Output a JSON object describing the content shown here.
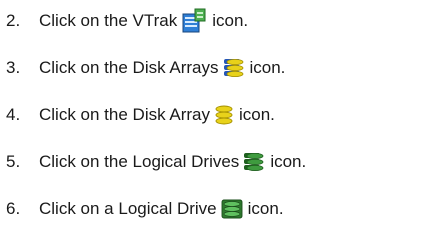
{
  "steps": [
    {
      "number": "2.",
      "text_before": "Click on the VTrak",
      "icon": "vtrak-icon",
      "text_after": "icon."
    },
    {
      "number": "3.",
      "text_before": "Click on the Disk Arrays",
      "icon": "disk-arrays-icon",
      "text_after": "icon."
    },
    {
      "number": "4.",
      "text_before": "Click on the Disk Array",
      "icon": "disk-array-icon",
      "text_after": "icon."
    },
    {
      "number": "5.",
      "text_before": "Click on the Logical Drives",
      "icon": "logical-drives-icon",
      "text_after": "icon."
    },
    {
      "number": "6.",
      "text_before": "Click on a Logical Drive",
      "icon": "logical-drive-icon",
      "text_after": "icon."
    }
  ],
  "colors": {
    "text": "#1a1a1a",
    "vtrak_blue": "#2f7fd6",
    "vtrak_green": "#4caf50",
    "disk_yellow": "#e8d21a",
    "disk_blue": "#2456b8",
    "drive_green": "#3f9b3f"
  }
}
